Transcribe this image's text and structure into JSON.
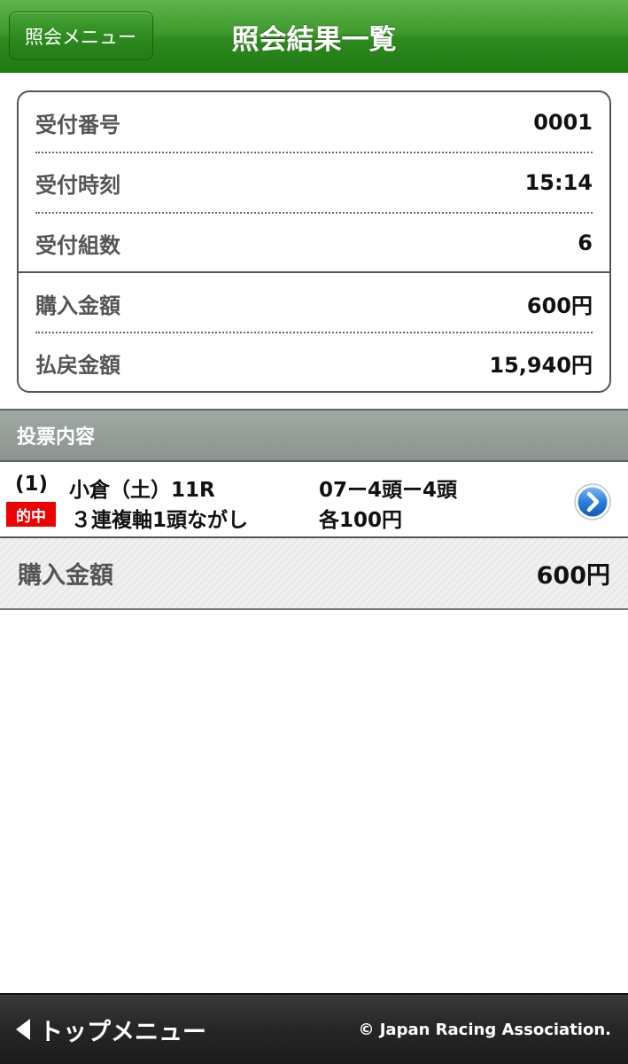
{
  "header": {
    "back_label": "照会メニュー",
    "title": "照会結果一覧"
  },
  "summary": {
    "rows": [
      {
        "label": "受付番号",
        "value": "0001"
      },
      {
        "label": "受付時刻",
        "value": "15:14"
      },
      {
        "label": "受付組数",
        "value": "6"
      },
      {
        "label": "購入金額",
        "value": "600円"
      },
      {
        "label": "払戻金額",
        "value": "15,940円"
      }
    ]
  },
  "section": {
    "title": "投票内容"
  },
  "bet": {
    "index": "(1)",
    "race": "小倉（土）11R",
    "combination": "07ー4頭ー4頭",
    "badge": "的中",
    "type": "３連複軸1頭ながし",
    "unit_amount": "各100円"
  },
  "total": {
    "label": "購入金額",
    "value": "600円"
  },
  "footer": {
    "top_menu_label": "トップメニュー",
    "copyright": "© Japan Racing Association."
  },
  "colors": {
    "header_green": "#3f9a2c",
    "section_gray": "#959e98",
    "hit_red": "#ee0000",
    "footer_dark": "#262626",
    "go_blue": "#1e6fd0"
  }
}
